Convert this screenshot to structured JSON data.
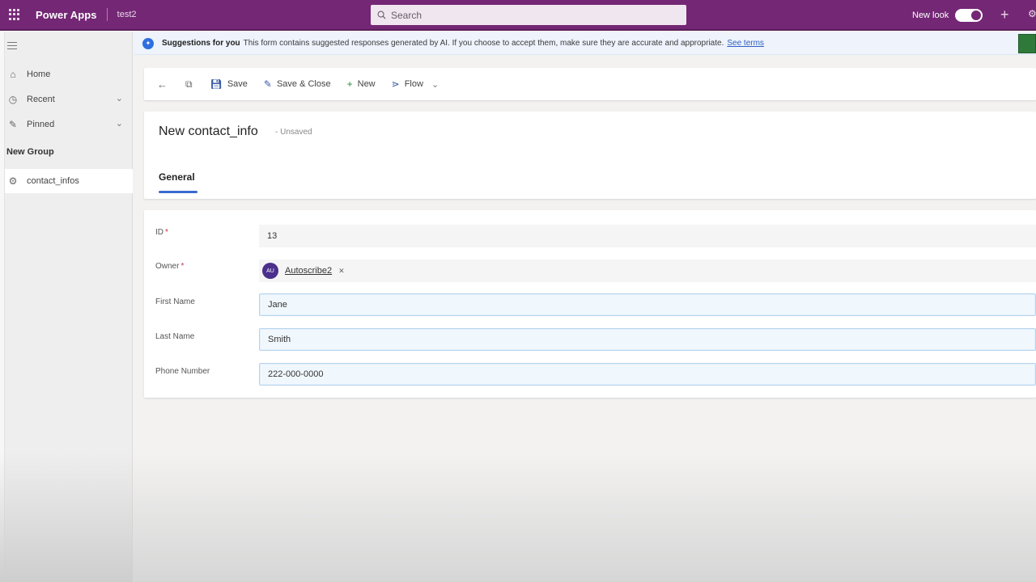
{
  "app": {
    "brand": "Power Apps",
    "environment": "test2",
    "search_placeholder": "Search",
    "new_look_label": "New look"
  },
  "sidebar": {
    "items": [
      {
        "label": "Home",
        "icon": "home-icon"
      },
      {
        "label": "Recent",
        "icon": "clock-icon"
      },
      {
        "label": "Pinned",
        "icon": "pin-icon"
      }
    ],
    "group_label": "New Group",
    "group_items": [
      {
        "label": "contact_infos",
        "icon": "table-icon"
      }
    ]
  },
  "banner": {
    "title": "Suggestions for you",
    "text": "This form contains suggested responses generated by AI. If you choose to accept them, make sure they are accurate and appropriate.",
    "link": "See terms"
  },
  "commands": {
    "save": "Save",
    "save_close": "Save & Close",
    "new": "New",
    "flow": "Flow"
  },
  "record": {
    "title": "New contact_info",
    "status": "- Unsaved",
    "tab": "General"
  },
  "form": {
    "id_label": "ID",
    "id_value": "13",
    "owner_label": "Owner",
    "owner_initials": "AU",
    "owner_value": "Autoscribe2",
    "first_name_label": "First Name",
    "first_name_value": "Jane",
    "last_name_label": "Last Name",
    "last_name_value": "Smith",
    "phone_label": "Phone Number",
    "phone_value": "222-000-0000"
  },
  "colors": {
    "brand_purple": "#742774",
    "accent_blue": "#3a6ad1",
    "required_red": "#c4314b"
  }
}
